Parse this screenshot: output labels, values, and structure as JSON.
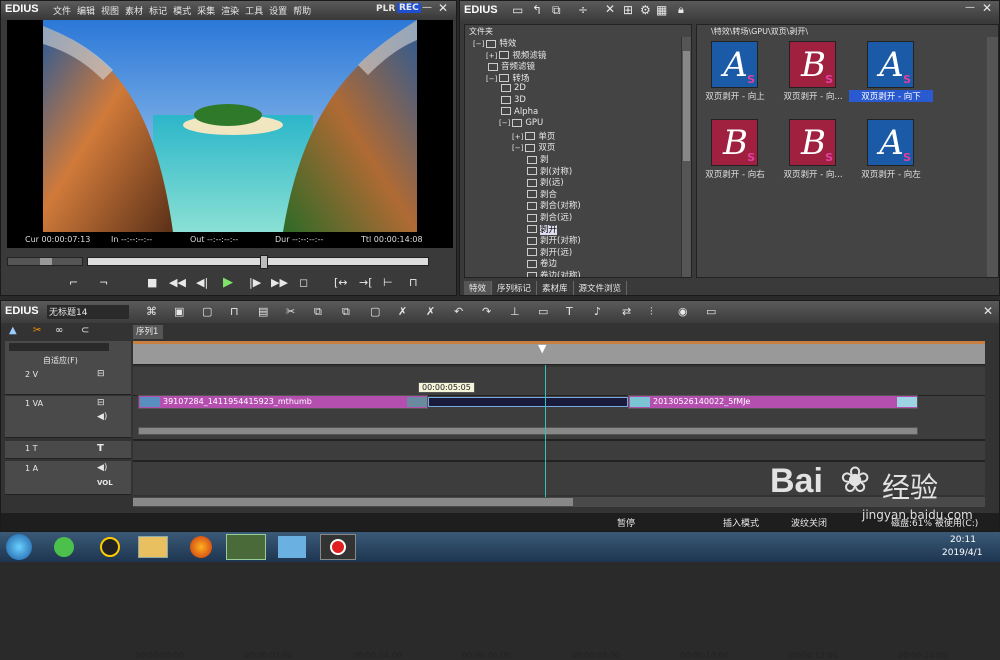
{
  "player": {
    "app": "EDIUS",
    "menu": [
      "文件",
      "编辑",
      "视图",
      "素材",
      "标记",
      "模式",
      "采集",
      "渲染",
      "工具",
      "设置",
      "帮助"
    ],
    "plr": "PLR",
    "rec": "REC",
    "timecodes": {
      "cur": "Cur 00:00:07:13",
      "in": "In --:--:--:--",
      "out": "Out --:--:--:--",
      "dur": "Dur --:--:--:--",
      "ttl": "Ttl 00:00:14:08"
    }
  },
  "effects": {
    "app": "EDIUS",
    "tree_header": "文件夹",
    "path": "\\特效\\转场\\GPU\\双页\\剥开\\",
    "tree": [
      {
        "label": "特效",
        "indent": 0,
        "exp": "−"
      },
      {
        "label": "视频滤镜",
        "indent": 1,
        "exp": "+"
      },
      {
        "label": "音频滤镜",
        "indent": 1,
        "exp": ""
      },
      {
        "label": "转场",
        "indent": 1,
        "exp": "−"
      },
      {
        "label": "2D",
        "indent": 2,
        "exp": ""
      },
      {
        "label": "3D",
        "indent": 2,
        "exp": ""
      },
      {
        "label": "Alpha",
        "indent": 2,
        "exp": ""
      },
      {
        "label": "GPU",
        "indent": 2,
        "exp": "−"
      },
      {
        "label": "单页",
        "indent": 3,
        "exp": "+"
      },
      {
        "label": "双页",
        "indent": 3,
        "exp": "−"
      },
      {
        "label": "剥",
        "indent": 4,
        "exp": ""
      },
      {
        "label": "剥(对称)",
        "indent": 4,
        "exp": ""
      },
      {
        "label": "剥(远)",
        "indent": 4,
        "exp": ""
      },
      {
        "label": "剥合",
        "indent": 4,
        "exp": ""
      },
      {
        "label": "剥合(对称)",
        "indent": 4,
        "exp": ""
      },
      {
        "label": "剥合(远)",
        "indent": 4,
        "exp": ""
      },
      {
        "label": "剥开",
        "indent": 4,
        "exp": ""
      },
      {
        "label": "剥开(对称)",
        "indent": 4,
        "exp": ""
      },
      {
        "label": "剥开(远)",
        "indent": 4,
        "exp": ""
      },
      {
        "label": "卷边",
        "indent": 4,
        "exp": ""
      },
      {
        "label": "卷边(对称)",
        "indent": 4,
        "exp": ""
      }
    ],
    "thumbs": [
      {
        "letter": "A",
        "label": "双页剥开 - 向上",
        "bg": "#1a5aa6"
      },
      {
        "letter": "B",
        "label": "双页剥开 - 向...",
        "bg": "#a02040"
      },
      {
        "letter": "A",
        "label": "双页剥开 - 向下",
        "bg": "#1a5aa6"
      },
      {
        "letter": "B",
        "label": "双页剥开 - 向右",
        "bg": "#a02040"
      },
      {
        "letter": "B",
        "label": "双页剥开 - 向...",
        "bg": "#a02040"
      },
      {
        "letter": "A",
        "label": "双页剥开 - 向左",
        "bg": "#1a5aa6"
      }
    ],
    "tabs": [
      "特效",
      "序列标记",
      "素材库",
      "源文件浏览"
    ]
  },
  "timeline": {
    "app": "EDIUS",
    "project": "无标题14",
    "sequence_tab": "序列1",
    "mode": "自适应(F)",
    "ruler": [
      "00:00:00:00",
      "00:00:02:00",
      "00:00:04:00",
      "00:00:06:00",
      "00:00:08:00",
      "00:00:10:00",
      "00:00:12:00",
      "00:00:14:00"
    ],
    "tooltip": "00:00:05:05",
    "tracks": [
      "2 V",
      "1 VA",
      "1 T",
      "1 A"
    ],
    "vol": "VOL",
    "clip1": "39107284_1411954415923_mthumb",
    "clip2": "20130526140022_5fMJe"
  },
  "status": {
    "pause": "暂停",
    "insert": "插入模式",
    "ripple": "波纹关闭",
    "disk": "磁盘:61% 被使用(C:)"
  },
  "taskbar": {
    "time": "20:11",
    "date": "2019/4/1"
  },
  "watermark": {
    "brand": "Bai",
    "brand2": "经验",
    "url": "jingyan.baidu.com"
  }
}
